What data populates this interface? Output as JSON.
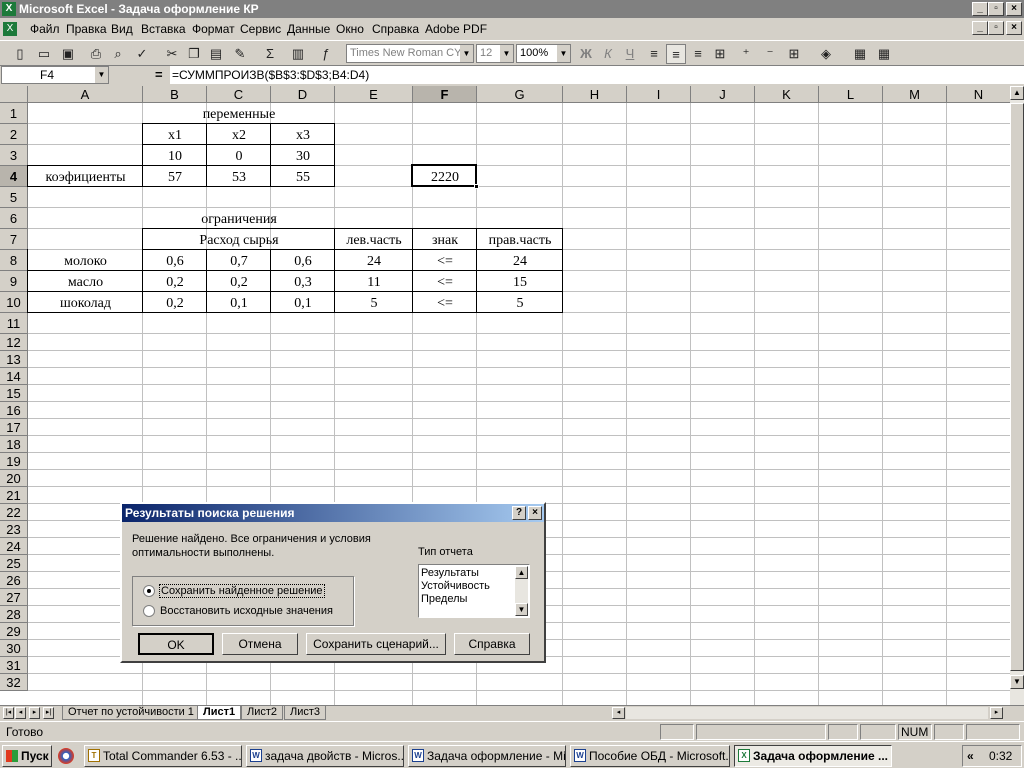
{
  "window": {
    "title": "Microsoft Excel - Задача оформление КР"
  },
  "menu": [
    "Файл",
    "Правка",
    "Вид",
    "Вставка",
    "Формат",
    "Сервис",
    "Данные",
    "Окно",
    "Справка",
    "Adobe PDF"
  ],
  "toolbar": {
    "font": "Times New Roman CYR",
    "size": "12",
    "zoom": "100%"
  },
  "formula_bar": {
    "name_box": "F4",
    "formula": "=СУММПРОИЗВ($B$3:$D$3;B4:D4)"
  },
  "columns": [
    "A",
    "B",
    "C",
    "D",
    "E",
    "F",
    "G",
    "H",
    "I",
    "J",
    "K",
    "L",
    "M",
    "N"
  ],
  "rows": [
    "1",
    "2",
    "3",
    "4",
    "5",
    "6",
    "7",
    "8",
    "9",
    "10",
    "11",
    "12",
    "13",
    "14",
    "15",
    "16",
    "17",
    "18",
    "19",
    "20",
    "21",
    "22",
    "23",
    "24",
    "25",
    "26",
    "27",
    "28",
    "29",
    "30",
    "31",
    "32"
  ],
  "cells": {
    "B1": "переменные",
    "B2": "x1",
    "C2": "x2",
    "D2": "x3",
    "B3": "10",
    "C3": "0",
    "D3": "30",
    "A4": "коэфициенты",
    "B4": "57",
    "C4": "53",
    "D4": "55",
    "F4": "2220",
    "B6": "ограничения",
    "B7": "Расход  сырья",
    "E7": "лев.часть",
    "F7": "знак",
    "G7": "прав.часть",
    "A8": "молоко",
    "B8": "0,6",
    "C8": "0,7",
    "D8": "0,6",
    "E8": "24",
    "F8": "<=",
    "G8": "24",
    "A9": "масло",
    "B9": "0,2",
    "C9": "0,2",
    "D9": "0,3",
    "E9": "11",
    "F9": "<=",
    "G9": "15",
    "A10": "шоколад",
    "B10": "0,2",
    "C10": "0,1",
    "D10": "0,1",
    "E10": "5",
    "F10": "<=",
    "G10": "5"
  },
  "sheet_tabs": [
    "Отчет по устойчивости 1",
    "Лист1",
    "Лист2",
    "Лист3"
  ],
  "status": {
    "ready": "Готово",
    "num": "NUM"
  },
  "dialog": {
    "title": "Результаты поиска решения",
    "message_line1": "Решение найдено. Все ограничения и условия",
    "message_line2": "оптимальности выполнены.",
    "report_type_label": "Тип отчета",
    "reports": [
      "Результаты",
      "Устойчивость",
      "Пределы"
    ],
    "radio_keep": "Сохранить найденное решение",
    "radio_restore": "Восстановить исходные значения",
    "btn_ok": "OK",
    "btn_cancel": "Отмена",
    "btn_save_scenario": "Сохранить сценарий...",
    "btn_help": "Справка",
    "help_btn": "?",
    "close_btn": "×"
  },
  "taskbar": {
    "start": "Пуск",
    "tasks": [
      "Total Commander 6.53 - ...",
      "задача двойств - Micros...",
      "Задача оформление - Mi...",
      "Пособие ОБД - Microsoft...",
      "Задача оформление ..."
    ],
    "clock": "0:32",
    "tray_arrow": "«"
  }
}
